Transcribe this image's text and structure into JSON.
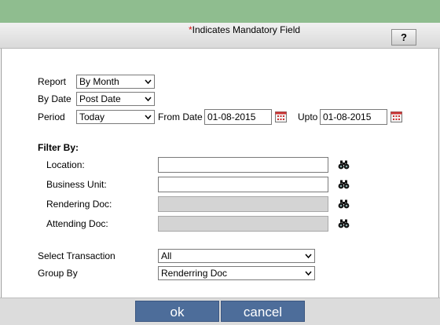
{
  "header": {
    "mandatory_star": "*",
    "mandatory_text": "Indicates Mandatory Field",
    "help_label": "?"
  },
  "form": {
    "report": {
      "label": "Report",
      "value": "By Month"
    },
    "by_date": {
      "label": "By Date",
      "value": "Post Date"
    },
    "period": {
      "label": "Period",
      "value": "Today"
    },
    "from_date": {
      "label": "From Date",
      "value": "01-08-2015"
    },
    "upto": {
      "label": "Upto",
      "value": "01-08-2015"
    },
    "filter_heading": "Filter By:",
    "location": {
      "label": "Location:",
      "value": ""
    },
    "business_unit": {
      "label": "Business Unit:",
      "value": ""
    },
    "rendering_doc": {
      "label": "Rendering Doc:",
      "value": ""
    },
    "attending_doc": {
      "label": "Attending Doc:",
      "value": ""
    },
    "select_transaction": {
      "label": "Select Transaction",
      "value": "All"
    },
    "group_by": {
      "label": "Group By",
      "value": "Renderring Doc"
    }
  },
  "buttons": {
    "ok": "ok",
    "cancel": "cancel"
  },
  "colors": {
    "topbar": "#8fbd8f",
    "button": "#4d6d9a",
    "mandatory_star": "#dd1111"
  }
}
